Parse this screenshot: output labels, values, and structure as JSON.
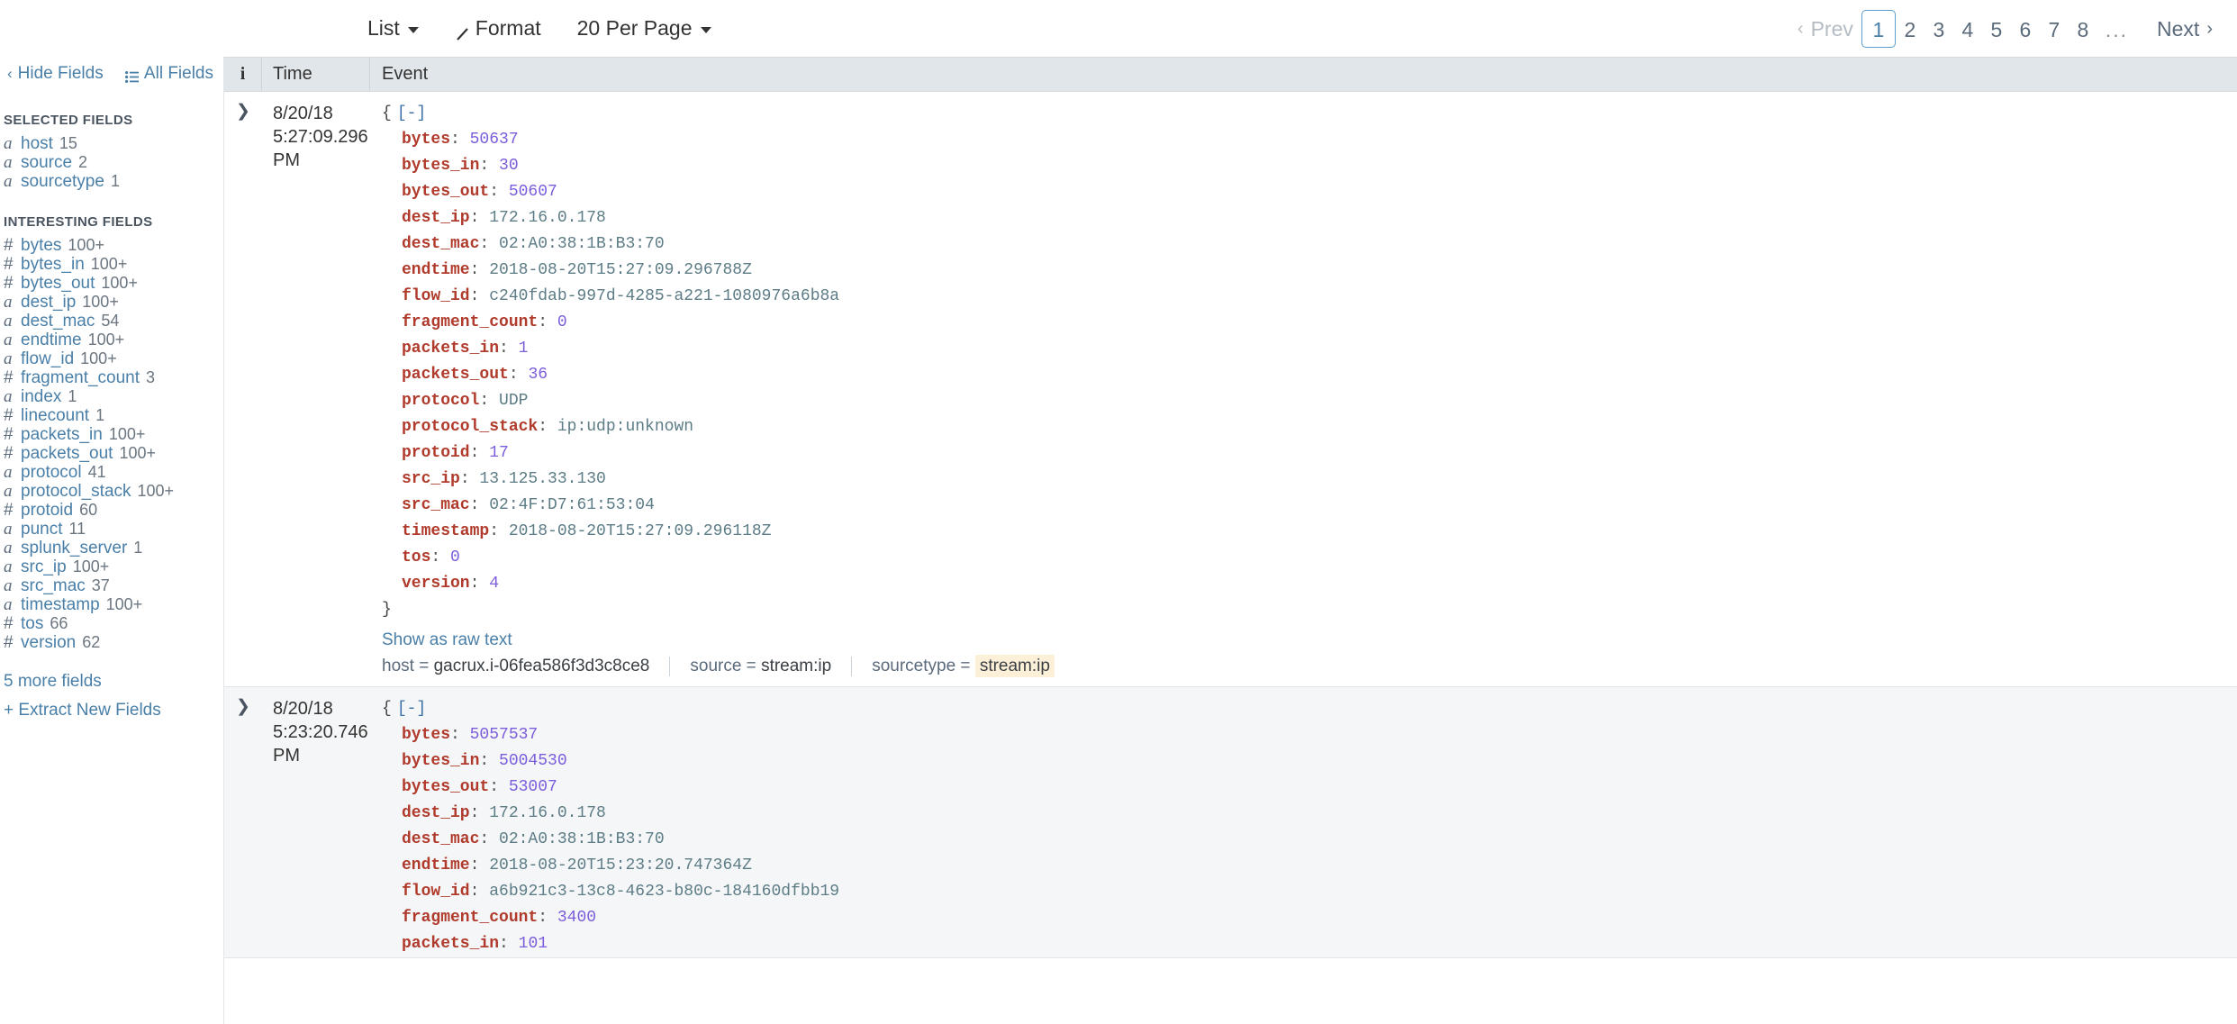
{
  "toolbar": {
    "view_mode": "List",
    "format_label": "Format",
    "per_page": "20 Per Page"
  },
  "pagination": {
    "prev_label": "Prev",
    "next_label": "Next",
    "pages": [
      "1",
      "2",
      "3",
      "4",
      "5",
      "6",
      "7",
      "8"
    ],
    "ellipsis": "...",
    "active_page": "1"
  },
  "sidebar": {
    "hide_fields_label": "Hide Fields",
    "all_fields_label": "All Fields",
    "selected_fields_heading": "SELECTED FIELDS",
    "selected_fields": [
      {
        "type": "a",
        "name": "host",
        "count": "15"
      },
      {
        "type": "a",
        "name": "source",
        "count": "2"
      },
      {
        "type": "a",
        "name": "sourcetype",
        "count": "1"
      }
    ],
    "interesting_fields_heading": "INTERESTING FIELDS",
    "interesting_fields": [
      {
        "type": "#",
        "name": "bytes",
        "count": "100+"
      },
      {
        "type": "#",
        "name": "bytes_in",
        "count": "100+"
      },
      {
        "type": "#",
        "name": "bytes_out",
        "count": "100+"
      },
      {
        "type": "a",
        "name": "dest_ip",
        "count": "100+"
      },
      {
        "type": "a",
        "name": "dest_mac",
        "count": "54"
      },
      {
        "type": "a",
        "name": "endtime",
        "count": "100+"
      },
      {
        "type": "a",
        "name": "flow_id",
        "count": "100+"
      },
      {
        "type": "#",
        "name": "fragment_count",
        "count": "3"
      },
      {
        "type": "a",
        "name": "index",
        "count": "1"
      },
      {
        "type": "#",
        "name": "linecount",
        "count": "1"
      },
      {
        "type": "#",
        "name": "packets_in",
        "count": "100+"
      },
      {
        "type": "#",
        "name": "packets_out",
        "count": "100+"
      },
      {
        "type": "a",
        "name": "protocol",
        "count": "41"
      },
      {
        "type": "a",
        "name": "protocol_stack",
        "count": "100+"
      },
      {
        "type": "#",
        "name": "protoid",
        "count": "60"
      },
      {
        "type": "a",
        "name": "punct",
        "count": "11"
      },
      {
        "type": "a",
        "name": "splunk_server",
        "count": "1"
      },
      {
        "type": "a",
        "name": "src_ip",
        "count": "100+"
      },
      {
        "type": "a",
        "name": "src_mac",
        "count": "37"
      },
      {
        "type": "a",
        "name": "timestamp",
        "count": "100+"
      },
      {
        "type": "#",
        "name": "tos",
        "count": "66"
      },
      {
        "type": "#",
        "name": "version",
        "count": "62"
      }
    ],
    "more_fields_label": "5 more fields",
    "extract_fields_label": "+ Extract New Fields"
  },
  "table": {
    "columns": {
      "info": "i",
      "time": "Time",
      "event": "Event"
    }
  },
  "events": [
    {
      "date": "8/20/18",
      "time": "5:27:09.296 PM",
      "open_brace": "{",
      "toggle": "[-]",
      "close_brace": "}",
      "fields": [
        {
          "key": "bytes",
          "value": "50637",
          "kind": "num"
        },
        {
          "key": "bytes_in",
          "value": "30",
          "kind": "num"
        },
        {
          "key": "bytes_out",
          "value": "50607",
          "kind": "num"
        },
        {
          "key": "dest_ip",
          "value": "172.16.0.178",
          "kind": "str"
        },
        {
          "key": "dest_mac",
          "value": "02:A0:38:1B:B3:70",
          "kind": "str"
        },
        {
          "key": "endtime",
          "value": "2018-08-20T15:27:09.296788Z",
          "kind": "str"
        },
        {
          "key": "flow_id",
          "value": "c240fdab-997d-4285-a221-1080976a6b8a",
          "kind": "str"
        },
        {
          "key": "fragment_count",
          "value": "0",
          "kind": "num"
        },
        {
          "key": "packets_in",
          "value": "1",
          "kind": "num"
        },
        {
          "key": "packets_out",
          "value": "36",
          "kind": "num"
        },
        {
          "key": "protocol",
          "value": "UDP",
          "kind": "str"
        },
        {
          "key": "protocol_stack",
          "value": "ip:udp:unknown",
          "kind": "str"
        },
        {
          "key": "protoid",
          "value": "17",
          "kind": "num"
        },
        {
          "key": "src_ip",
          "value": "13.125.33.130",
          "kind": "str"
        },
        {
          "key": "src_mac",
          "value": "02:4F:D7:61:53:04",
          "kind": "str"
        },
        {
          "key": "timestamp",
          "value": "2018-08-20T15:27:09.296118Z",
          "kind": "str"
        },
        {
          "key": "tos",
          "value": "0",
          "kind": "num"
        },
        {
          "key": "version",
          "value": "4",
          "kind": "num"
        }
      ],
      "raw_text_link": "Show as raw text",
      "meta": {
        "host_key": "host =",
        "host_value": "gacrux.i-06fea586f3d3c8ce8",
        "source_key": "source =",
        "source_value": "stream:ip",
        "sourcetype_key": "sourcetype =",
        "sourcetype_value": "stream:ip"
      }
    },
    {
      "date": "8/20/18",
      "time": "5:23:20.746 PM",
      "open_brace": "{",
      "toggle": "[-]",
      "fields": [
        {
          "key": "bytes",
          "value": "5057537",
          "kind": "num"
        },
        {
          "key": "bytes_in",
          "value": "5004530",
          "kind": "num"
        },
        {
          "key": "bytes_out",
          "value": "53007",
          "kind": "num"
        },
        {
          "key": "dest_ip",
          "value": "172.16.0.178",
          "kind": "str"
        },
        {
          "key": "dest_mac",
          "value": "02:A0:38:1B:B3:70",
          "kind": "str"
        },
        {
          "key": "endtime",
          "value": "2018-08-20T15:23:20.747364Z",
          "kind": "str"
        },
        {
          "key": "flow_id",
          "value": "a6b921c3-13c8-4623-b80c-184160dfbb19",
          "kind": "str"
        },
        {
          "key": "fragment_count",
          "value": "3400",
          "kind": "num"
        },
        {
          "key": "packets_in",
          "value": "101",
          "kind": "num"
        }
      ]
    }
  ],
  "colors": {
    "key": "#b03a2b",
    "number": "#7b5ddb",
    "string": "#5c7c86",
    "link": "#4a7fa8",
    "highlight": "#fcf0d8",
    "header_bg": "#e1e6ea"
  }
}
